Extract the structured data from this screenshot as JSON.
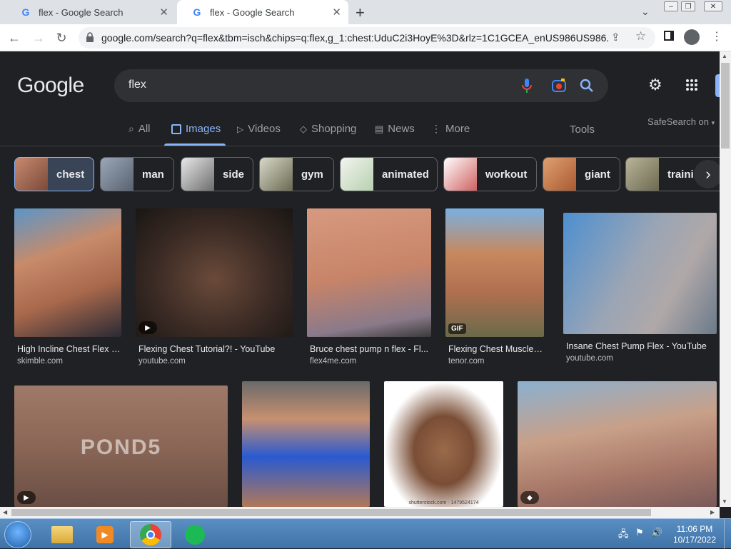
{
  "browser": {
    "tabs": [
      {
        "title": "flex - Google Search"
      },
      {
        "title": "flex - Google Search"
      }
    ],
    "url": "google.com/search?q=flex&tbm=isch&chips=q:flex,g_1:chest:UduC2i3HoyE%3D&rlz=1C1GCEA_enUS986US986..."
  },
  "google": {
    "logo": "Google",
    "query": "flex",
    "nav_tabs": [
      {
        "label": "All"
      },
      {
        "label": "Images"
      },
      {
        "label": "Videos"
      },
      {
        "label": "Shopping"
      },
      {
        "label": "News"
      },
      {
        "label": "More"
      }
    ],
    "tools": "Tools",
    "safesearch": "SafeSearch on",
    "chips": [
      {
        "label": "chest"
      },
      {
        "label": "man"
      },
      {
        "label": "side"
      },
      {
        "label": "gym"
      },
      {
        "label": "animated"
      },
      {
        "label": "workout"
      },
      {
        "label": "giant"
      },
      {
        "label": "trainin"
      }
    ],
    "results": [
      {
        "title": "High Incline Chest Flex -...",
        "source": "skimble.com"
      },
      {
        "title": "Flexing Chest Tutorial?! - YouTube",
        "source": "youtube.com"
      },
      {
        "title": "Bruce chest pump n flex - Fl...",
        "source": "flex4me.com"
      },
      {
        "title": "Flexing Chest Muscles ...",
        "source": "tenor.com",
        "badge": "GIF"
      },
      {
        "title": "Insane Chest Pump Flex - YouTube",
        "source": "youtube.com"
      }
    ],
    "row2_watermarks": {
      "pond5": "POND5",
      "shutterstock": "shutterstock.com · 1479524174"
    }
  },
  "taskbar": {
    "time": "11:06 PM",
    "date": "10/17/2022"
  },
  "colors": {
    "page_bg": "#202124",
    "accent": "#8ab4f8",
    "chip_active": "#394457"
  }
}
